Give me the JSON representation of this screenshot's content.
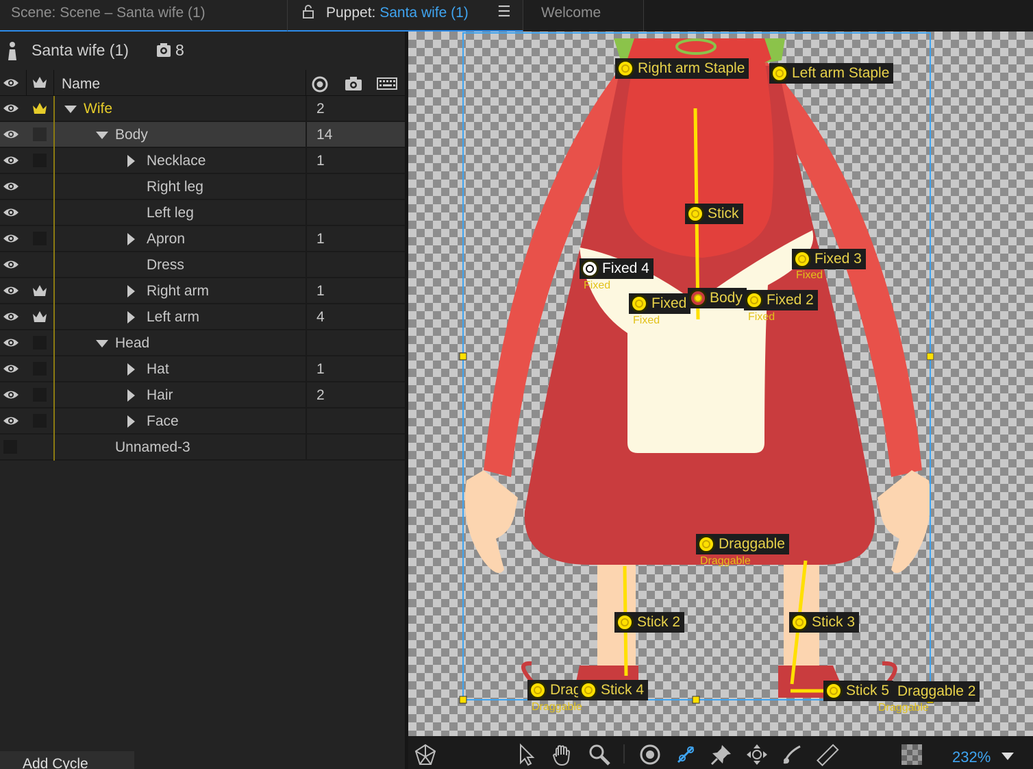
{
  "tabs": {
    "scene": "Scene: Scene – Santa wife (1)",
    "puppet_prefix": "Puppet: ",
    "puppet_name": "Santa wife (1)",
    "welcome": "Welcome"
  },
  "panel": {
    "puppet_name": "Santa wife (1)",
    "handle_count": "8",
    "col_name": "Name"
  },
  "rows": [
    {
      "label": "Wife",
      "count": "2"
    },
    {
      "label": "Body",
      "count": "14"
    },
    {
      "label": "Necklace",
      "count": "1"
    },
    {
      "label": "Right leg",
      "count": ""
    },
    {
      "label": "Left leg",
      "count": ""
    },
    {
      "label": "Apron",
      "count": "1"
    },
    {
      "label": "Dress",
      "count": ""
    },
    {
      "label": "Right arm",
      "count": "1"
    },
    {
      "label": "Left arm",
      "count": "4"
    },
    {
      "label": "Head",
      "count": ""
    },
    {
      "label": "Hat",
      "count": "1"
    },
    {
      "label": "Hair",
      "count": "2"
    },
    {
      "label": "Face",
      "count": ""
    },
    {
      "label": "Unnamed-3",
      "count": ""
    }
  ],
  "add_cycle": "Add Cycle",
  "handles": {
    "right_arm_staple": "Right arm Staple",
    "left_arm_staple": "Left arm Staple",
    "stick": "Stick",
    "fixed_4": "Fixed 4",
    "fixed_3": "Fixed 3",
    "fixed": "Fixed",
    "body": "Body",
    "fixed_2": "Fixed 2",
    "draggable": "Draggable",
    "stick_2": "Stick 2",
    "stick_3": "Stick 3",
    "dragg_trunc": "Dragg",
    "stick_4": "Stick 4",
    "stick_5": "Stick 5",
    "draggable_2": "Draggable 2",
    "sub_fixed": "Fixed",
    "sub_draggable": "Draggable"
  },
  "zoom": "232%",
  "colors": {
    "accent": "#3fa4f0",
    "handle": "#ffe000",
    "dress": "#c93c3e",
    "arm": "#e8514a",
    "apron": "#fdf8e0",
    "skin": "#fcd5b0"
  }
}
